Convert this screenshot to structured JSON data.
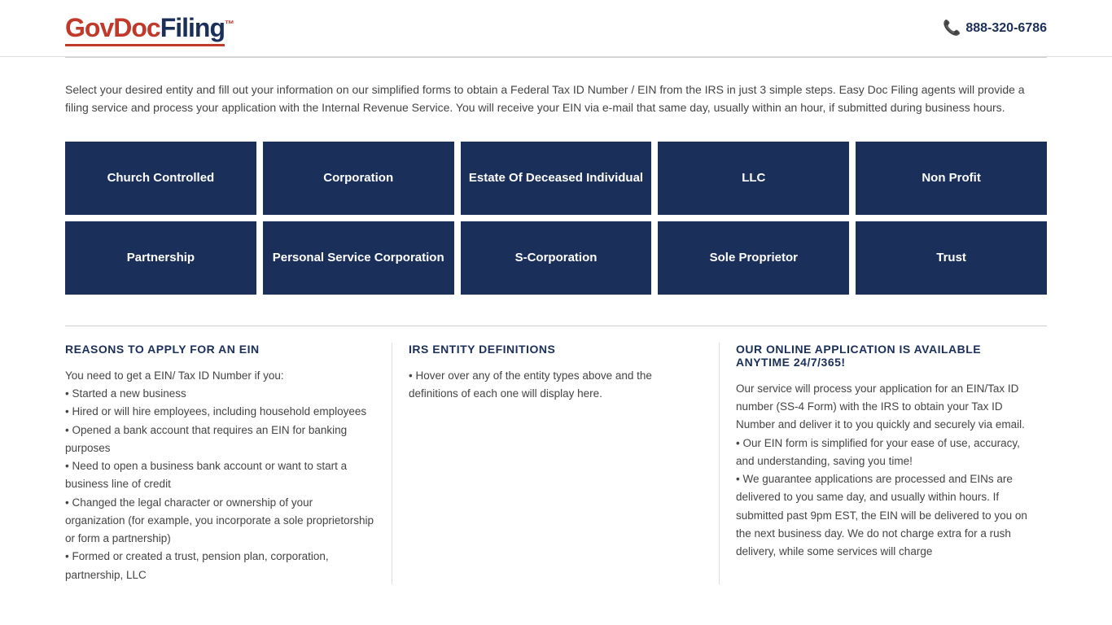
{
  "header": {
    "logo_gov": "GovDoc",
    "logo_filing": "Filing",
    "logo_tm": "™",
    "phone_number": "888-320-6786",
    "phone_icon": "📞"
  },
  "intro": {
    "text": "Select your desired entity and fill out your information on our simplified forms to obtain a Federal Tax ID Number / EIN from the IRS in just 3 simple steps. Easy Doc Filing agents will provide a filing service and process your application with the Internal Revenue Service. You will receive your EIN via e-mail that same day, usually within an hour, if submitted during business hours."
  },
  "entity_buttons": {
    "row1": [
      {
        "label": "Church Controlled"
      },
      {
        "label": "Corporation"
      },
      {
        "label": "Estate Of Deceased Individual"
      },
      {
        "label": "LLC"
      },
      {
        "label": "Non Profit"
      }
    ],
    "row2": [
      {
        "label": "Partnership"
      },
      {
        "label": "Personal Service Corporation"
      },
      {
        "label": "S-Corporation"
      },
      {
        "label": "Sole Proprietor"
      },
      {
        "label": "Trust"
      }
    ]
  },
  "columns": {
    "col1": {
      "title": "REASONS TO APPLY FOR AN EIN",
      "text": "You need to get a EIN/ Tax ID Number if you:\n• Started a new business\n• Hired or will hire employees, including household employees\n• Opened a bank account that requires an EIN for banking purposes\n• Need to open a business bank account or want to start a business line of credit\n• Changed the legal character or ownership of your organization (for example, you incorporate a sole proprietorship or form a partnership)\n• Formed or created a trust, pension plan, corporation, partnership, LLC"
    },
    "col2": {
      "title": "IRS ENTITY DEFINITIONS",
      "text": "• Hover over any of the entity types above and the definitions of each one will display here."
    },
    "col3": {
      "title": "OUR ONLINE APPLICATION IS AVAILABLE ANYTIME 24/7/365!",
      "text": "Our service will process your application for an EIN/Tax ID number (SS-4 Form) with the IRS to obtain your Tax ID Number and deliver it to you quickly and securely via email.\n• Our EIN form is simplified for your ease of use, accuracy, and understanding, saving you time!\n• We guarantee applications are processed and EINs are delivered to you same day, and usually within hours. If submitted past 9pm EST, the EIN will be delivered to you on the next business day. We do not charge extra for a rush delivery, while some services will charge"
    }
  }
}
